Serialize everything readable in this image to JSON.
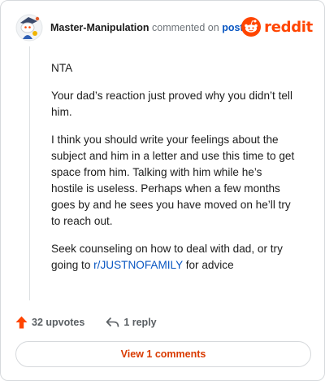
{
  "header": {
    "author": "Master-Manipulation",
    "meta_text": "commented on",
    "post_link": "post",
    "logo_text": "reddit",
    "avatar_icon": "reddit-snoo-avatar-icon",
    "logo_icon": "reddit-alien-logo-icon"
  },
  "comment": {
    "p1": "NTA",
    "p2": "Your dad’s reaction just proved why you didn’t tell him.",
    "p3": "I think you should write your feelings about the subject and him in a letter and use this time to get space from him. Talking with him while he’s hostile is useless. Perhaps when a few months goes by and he sees you have moved on he’ll try to reach out.",
    "p4_before": "Seek counseling on how to deal with dad, or try going to ",
    "p4_link": "r/JUSTNOFAMILY",
    "p4_after": " for advice"
  },
  "actions": {
    "upvotes": "32 upvotes",
    "replies": "1 reply",
    "upvote_icon": "upvote-arrow-icon",
    "reply_icon": "reply-arrow-icon"
  },
  "footer": {
    "view_comments": "View 1 comments"
  },
  "colors": {
    "brand": "#ff4500",
    "link": "#0a57c2",
    "view_button_text": "#d93a00",
    "border": "#d6d9dc"
  }
}
